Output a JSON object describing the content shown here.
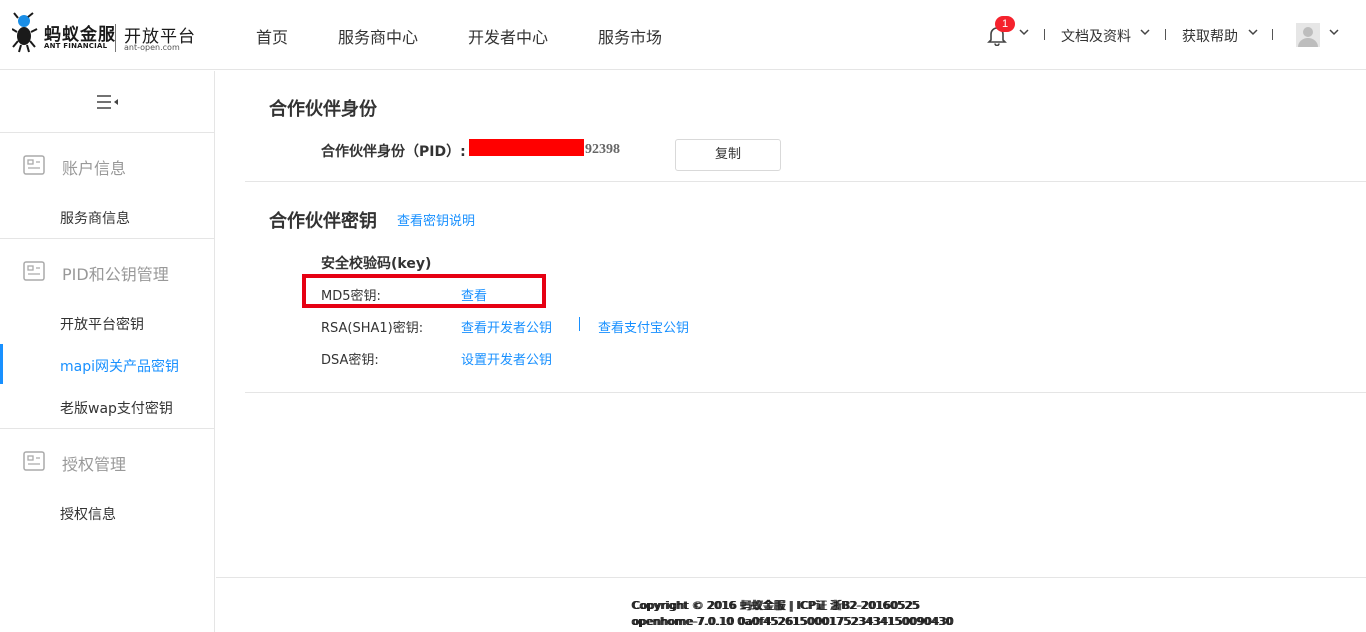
{
  "brand": {
    "name_cn": "蚂蚁金服",
    "name_en": "ANT FINANCIAL",
    "platform_cn": "开放平台",
    "platform_en": "ant-open.com"
  },
  "topnav": [
    "首页",
    "服务商中心",
    "开发者中心",
    "服务市场"
  ],
  "header_right": {
    "notification_count": "1",
    "docs_label": "文档及资料",
    "help_label": "获取帮助"
  },
  "sidebar": {
    "groups": [
      {
        "label": "账户信息",
        "items": [
          "服务商信息"
        ]
      },
      {
        "label": "PID和公钥管理",
        "items": [
          "开放平台密钥",
          "mapi网关产品密钥",
          "老版wap支付密钥"
        ]
      },
      {
        "label": "授权管理",
        "items": [
          "授权信息"
        ]
      }
    ],
    "active_item": "mapi网关产品密钥"
  },
  "main": {
    "partner_id_section": {
      "title": "合作伙伴身份",
      "pid_label": "合作伙伴身份（PID）:",
      "pid_visible_suffix": "92398",
      "copy_button": "复制"
    },
    "partner_key_section": {
      "title": "合作伙伴密钥",
      "help_link": "查看密钥说明",
      "key_heading": "安全校验码(key)",
      "rows": [
        {
          "label": "MD5密钥:",
          "links": [
            "查看"
          ]
        },
        {
          "label": "RSA(SHA1)密钥:",
          "links": [
            "查看开发者公钥",
            "查看支付宝公钥"
          ]
        },
        {
          "label": "DSA密钥:",
          "links": [
            "设置开发者公钥"
          ]
        }
      ]
    }
  },
  "footer": {
    "line1": "Copyright © 2016 蚂蚁金服 | ICP证 浙B2-20160525",
    "line2": "openhome-7.0.10   0a0f45261500017523434150090430"
  },
  "colors": {
    "accent": "#1890ff",
    "highlight_border": "#e60012",
    "redaction": "#ff0000",
    "badge": "#f5222d"
  }
}
